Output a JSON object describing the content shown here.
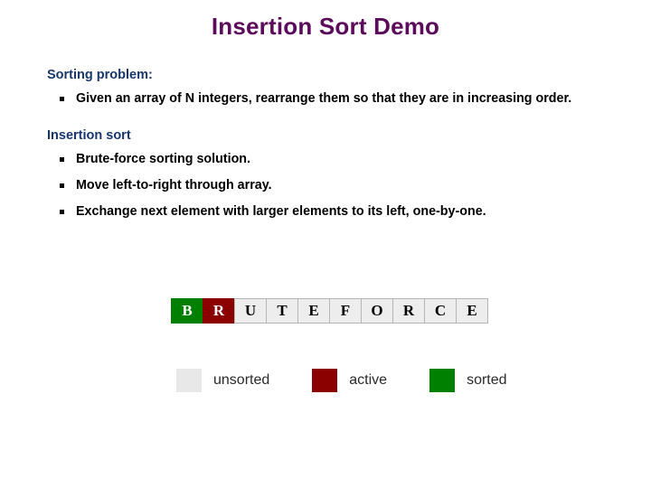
{
  "slide": {
    "title": "Insertion Sort Demo",
    "title_color": "#5c0a5c",
    "heading_color": "#17376e",
    "sections": [
      {
        "heading": "Sorting problem:",
        "bullets": [
          "Given an array of N integers, rearrange them so that they are in increasing order."
        ]
      },
      {
        "heading": "Insertion sort",
        "bullets": [
          "Brute-force sorting solution.",
          "Move left-to-right through array.",
          "Exchange next element with larger elements to its left, one-by-one."
        ]
      }
    ]
  },
  "array_demo": {
    "cells": [
      {
        "letter": "B",
        "state": "sorted"
      },
      {
        "letter": "R",
        "state": "active"
      },
      {
        "letter": "U",
        "state": "unsorted"
      },
      {
        "letter": "T",
        "state": "unsorted"
      },
      {
        "letter": "E",
        "state": "unsorted"
      },
      {
        "letter": "F",
        "state": "unsorted"
      },
      {
        "letter": "O",
        "state": "unsorted"
      },
      {
        "letter": "R",
        "state": "unsorted"
      },
      {
        "letter": "C",
        "state": "unsorted"
      },
      {
        "letter": "E",
        "state": "unsorted"
      }
    ]
  },
  "legend": {
    "items": [
      {
        "label": "unsorted",
        "color": "#e8e8e8",
        "state": "unsorted"
      },
      {
        "label": "active",
        "color": "#8b0000",
        "state": "active"
      },
      {
        "label": "sorted",
        "color": "#008000",
        "state": "sorted"
      }
    ]
  }
}
